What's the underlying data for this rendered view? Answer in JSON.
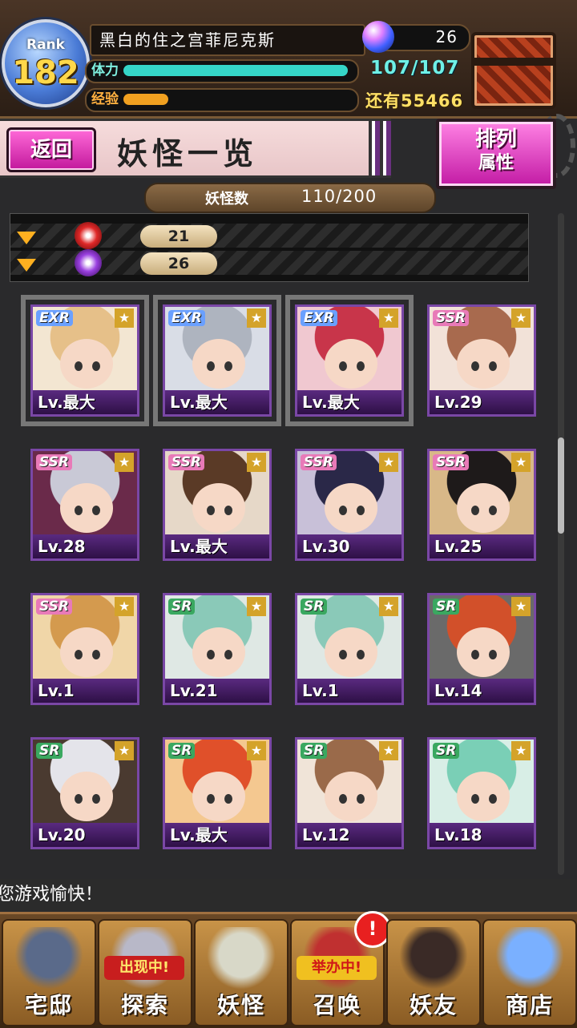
{
  "header": {
    "rank_word": "Rank",
    "rank_value": "182",
    "player_name": "黑白的住之宫菲尼克斯",
    "gems": "26",
    "stamina_label": "体力",
    "stamina_value": "107/107",
    "stamina_fill": 1.0,
    "exp_label": "经验",
    "exp_remaining": "还有55466",
    "exp_fill": 0.2
  },
  "titlebar": {
    "back_label": "返回",
    "title": "妖怪一览",
    "sort_line1": "排列",
    "sort_line2": "属性"
  },
  "count": {
    "label": "妖怪数",
    "value": "110/200"
  },
  "filters": [
    {
      "value": "21"
    },
    {
      "value": "26"
    }
  ],
  "cards": [
    {
      "rarity": "EXR",
      "level": "Lv.最大",
      "hair": "#e6c089",
      "bg": "#f3e6d2"
    },
    {
      "rarity": "EXR",
      "level": "Lv.最大",
      "hair": "#aeb4bf",
      "bg": "#d9dde6"
    },
    {
      "rarity": "EXR",
      "level": "Lv.最大",
      "hair": "#c8354a",
      "bg": "#f0c8d0"
    },
    {
      "rarity": "SSR",
      "level": "Lv.29",
      "hair": "#a86a4e",
      "bg": "#f2e2d8"
    },
    {
      "rarity": "SSR",
      "level": "Lv.28",
      "hair": "#c9c9d6",
      "bg": "#6a2a4a"
    },
    {
      "rarity": "SSR",
      "level": "Lv.最大",
      "hair": "#5a3a26",
      "bg": "#e6d8c8"
    },
    {
      "rarity": "SSR",
      "level": "Lv.30",
      "hair": "#2a2848",
      "bg": "#c8c0d8"
    },
    {
      "rarity": "SSR",
      "level": "Lv.25",
      "hair": "#1e1a1a",
      "bg": "#d8b888"
    },
    {
      "rarity": "SSR",
      "level": "Lv.1",
      "hair": "#d49a4e",
      "bg": "#f0d6a8"
    },
    {
      "rarity": "SR",
      "level": "Lv.21",
      "hair": "#8ac9b8",
      "bg": "#dfe8e4"
    },
    {
      "rarity": "SR",
      "level": "Lv.1",
      "hair": "#8ac9b8",
      "bg": "#dfe8e4"
    },
    {
      "rarity": "SR",
      "level": "Lv.14",
      "hair": "#d2502a",
      "bg": "#6a6a6a"
    },
    {
      "rarity": "SR",
      "level": "Lv.20",
      "hair": "#e4e4ea",
      "bg": "#4a3a30"
    },
    {
      "rarity": "SR",
      "level": "Lv.最大",
      "hair": "#e0502a",
      "bg": "#f4c890"
    },
    {
      "rarity": "SR",
      "level": "Lv.12",
      "hair": "#9a6a4a",
      "bg": "#f0e4d8"
    },
    {
      "rarity": "SR",
      "level": "Lv.18",
      "hair": "#7acfb6",
      "bg": "#d8eee6"
    }
  ],
  "ticker": "您游戏愉快！",
  "nav": [
    {
      "label": "宅邸",
      "banner": "",
      "icon_color": "#5a6a8a"
    },
    {
      "label": "探索",
      "banner": "出现中!",
      "icon_color": "#b8b8c8"
    },
    {
      "label": "妖怪",
      "banner": "",
      "icon_color": "#d8d8c8"
    },
    {
      "label": "召唤",
      "banner": "举办中!",
      "icon_color": "#c03030"
    },
    {
      "label": "妖友",
      "banner": "",
      "icon_color": "#3a2a26"
    },
    {
      "label": "商店",
      "banner": "",
      "icon_color": "#7ab0ff"
    }
  ],
  "nav_alert": "!",
  "colors": {
    "stamina": "#35d6c8",
    "exp": "#f0a020",
    "sort_button": "#e040c0",
    "back_button": "#e040c0"
  }
}
